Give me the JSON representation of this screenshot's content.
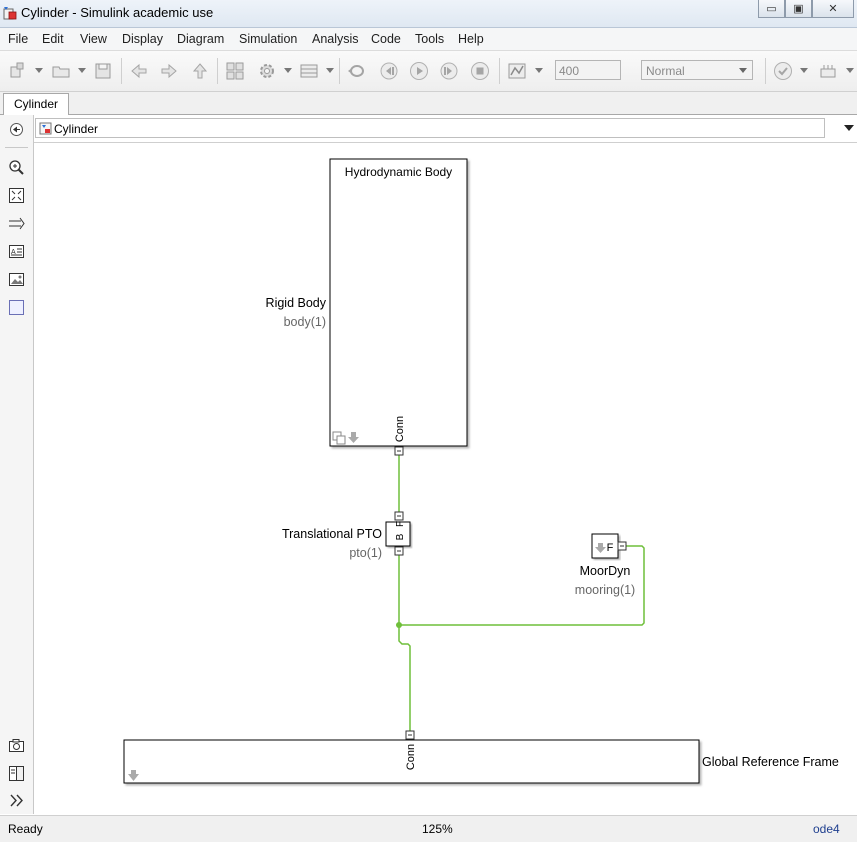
{
  "window": {
    "title": "Cylinder - Simulink academic use"
  },
  "menu": [
    "File",
    "Edit",
    "View",
    "Display",
    "Diagram",
    "Simulation",
    "Analysis",
    "Code",
    "Tools",
    "Help"
  ],
  "toolbar": {
    "stop_time": "400",
    "sim_mode": "Normal"
  },
  "tabs": [
    "Cylinder"
  ],
  "address": {
    "path": "Cylinder"
  },
  "blocks": {
    "hydro": {
      "title": "Hydrodynamic Body",
      "port": "Conn",
      "name": "Rigid Body",
      "param": "body(1)"
    },
    "pto": {
      "port_f": "F",
      "port_b": "B",
      "name": "Translational PTO",
      "param": "pto(1)"
    },
    "mooring": {
      "port": "F",
      "name": "MoorDyn",
      "param": "mooring(1)"
    },
    "ground": {
      "port": "Conn",
      "name": "Global Reference Frame"
    }
  },
  "colors": {
    "connection_line": "#6fbf3a",
    "param_text": "#666666",
    "solver_text": "#1f3f8f"
  },
  "status": {
    "state": "Ready",
    "zoom": "125%",
    "solver": "ode4"
  }
}
